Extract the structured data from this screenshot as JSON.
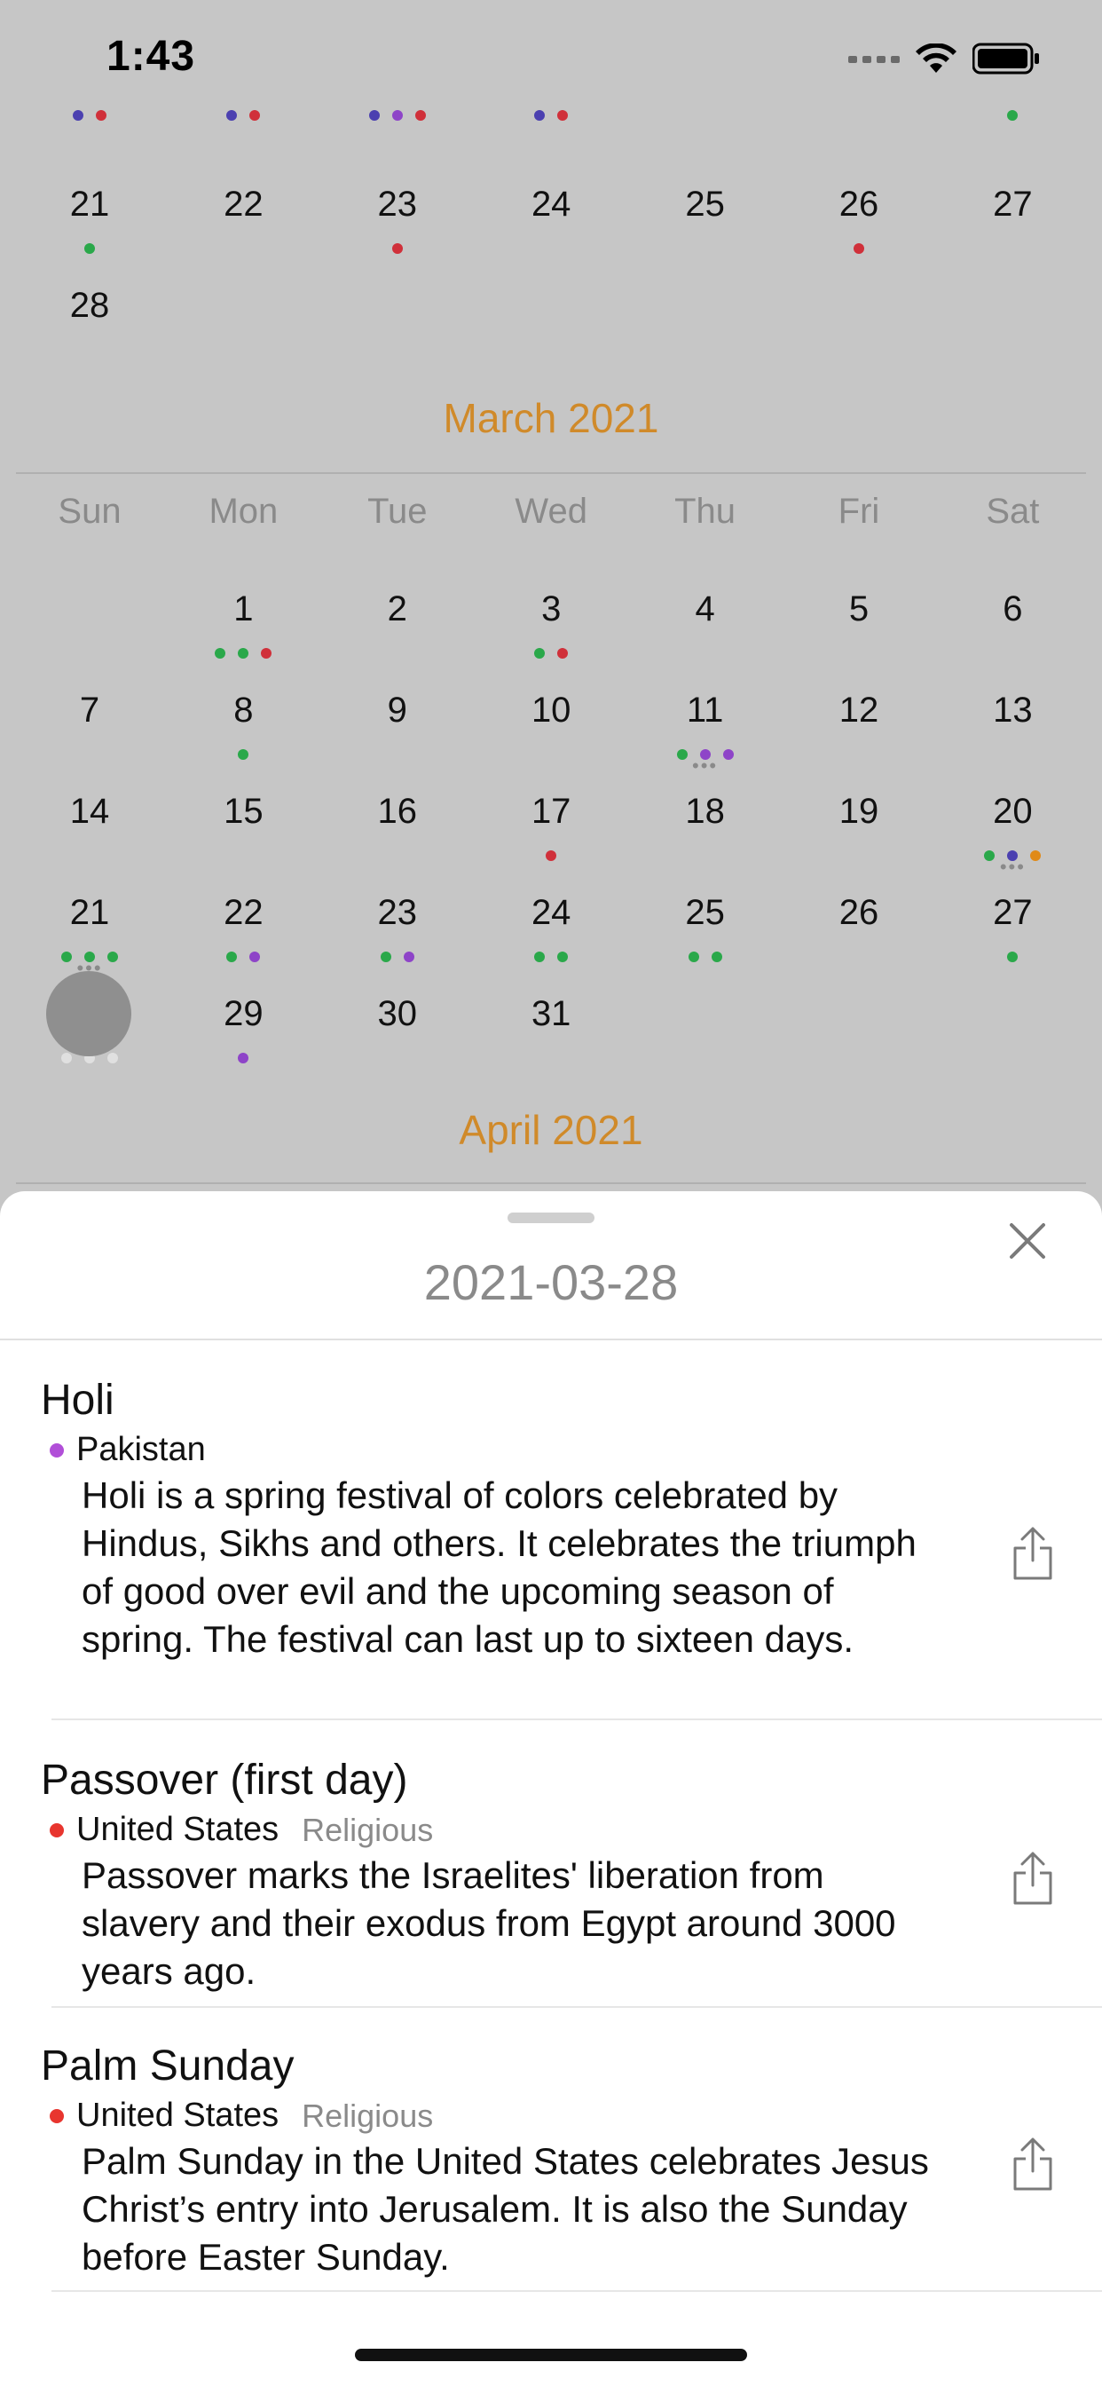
{
  "status": {
    "time": "1:43"
  },
  "feb_partial": {
    "top_dots": [
      [
        "#4b40b0",
        "#d0303a"
      ],
      [
        "#4b40b0",
        "#d0303a"
      ],
      [
        "#4b40b0",
        "#8e44c8",
        "#d0303a"
      ],
      [
        "#4b40b0",
        "#d0303a"
      ],
      [],
      [],
      [
        "#2aa84a"
      ]
    ],
    "row1": [
      {
        "n": "21",
        "dots": [
          "#2aa84a"
        ]
      },
      {
        "n": "22",
        "dots": []
      },
      {
        "n": "23",
        "dots": [
          "#d0303a"
        ]
      },
      {
        "n": "24",
        "dots": []
      },
      {
        "n": "25",
        "dots": []
      },
      {
        "n": "26",
        "dots": [
          "#d0303a"
        ]
      },
      {
        "n": "27",
        "dots": []
      }
    ],
    "row2": [
      {
        "n": "28",
        "dots": []
      }
    ]
  },
  "march": {
    "title": "March 2021",
    "weekdays": [
      "Sun",
      "Mon",
      "Tue",
      "Wed",
      "Thu",
      "Fri",
      "Sat"
    ],
    "weeks": [
      [
        null,
        {
          "n": "1",
          "dots": [
            "#2aa84a",
            "#2aa84a",
            "#d0303a"
          ]
        },
        {
          "n": "2",
          "dots": []
        },
        {
          "n": "3",
          "dots": [
            "#2aa84a",
            "#d0303a"
          ]
        },
        {
          "n": "4",
          "dots": []
        },
        {
          "n": "5",
          "dots": []
        },
        {
          "n": "6",
          "dots": []
        }
      ],
      [
        {
          "n": "7",
          "dots": []
        },
        {
          "n": "8",
          "dots": [
            "#2aa84a"
          ]
        },
        {
          "n": "9",
          "dots": []
        },
        {
          "n": "10",
          "dots": []
        },
        {
          "n": "11",
          "dots": [
            "#2aa84a",
            "#8e44c8",
            "#8e44c8"
          ],
          "more": true
        },
        {
          "n": "12",
          "dots": []
        },
        {
          "n": "13",
          "dots": []
        }
      ],
      [
        {
          "n": "14",
          "dots": []
        },
        {
          "n": "15",
          "dots": []
        },
        {
          "n": "16",
          "dots": []
        },
        {
          "n": "17",
          "dots": [
            "#d0303a"
          ]
        },
        {
          "n": "18",
          "dots": []
        },
        {
          "n": "19",
          "dots": []
        },
        {
          "n": "20",
          "dots": [
            "#2aa84a",
            "#4b40b0",
            "#e08a18"
          ],
          "more": true
        }
      ],
      [
        {
          "n": "21",
          "dots": [
            "#2aa84a",
            "#2aa84a",
            "#2aa84a"
          ],
          "more": true
        },
        {
          "n": "22",
          "dots": [
            "#2aa84a",
            "#8e44c8"
          ]
        },
        {
          "n": "23",
          "dots": [
            "#2aa84a",
            "#8e44c8"
          ]
        },
        {
          "n": "24",
          "dots": [
            "#2aa84a",
            "#2aa84a"
          ]
        },
        {
          "n": "25",
          "dots": [
            "#2aa84a",
            "#2aa84a"
          ]
        },
        {
          "n": "26",
          "dots": []
        },
        {
          "n": "27",
          "dots": [
            "#2aa84a"
          ]
        }
      ],
      [
        {
          "n": "28",
          "dots": [
            "#e0e0e0",
            "#e0e0e0",
            "#e0e0e0"
          ],
          "selected": true
        },
        {
          "n": "29",
          "dots": [
            "#8e44c8"
          ]
        },
        {
          "n": "30",
          "dots": []
        },
        {
          "n": "31",
          "dots": []
        },
        null,
        null,
        null
      ]
    ]
  },
  "april": {
    "title": "April 2021"
  },
  "sheet": {
    "date": "2021-03-28",
    "events": [
      {
        "title": "Holi",
        "country": "Pakistan",
        "dot_color": "#b14fd8",
        "tag": "",
        "description": "Holi is a spring festival of colors celebrated by Hindus, Sikhs and others. It celebrates the triumph of good over evil and the upcoming season of spring. The festival can last up to sixteen days."
      },
      {
        "title": "Passover (first day)",
        "country": "United States",
        "dot_color": "#e8352e",
        "tag": "Religious",
        "description": " Passover marks the Israelites' liberation from slavery and their exodus from Egypt around 3000 years ago."
      },
      {
        "title": "Palm Sunday",
        "country": "United States",
        "dot_color": "#e8352e",
        "tag": "Religious",
        "description": "Palm Sunday in the United States celebrates Jesus Christ’s entry into Jerusalem. It is also the Sunday before Easter Sunday."
      }
    ]
  }
}
